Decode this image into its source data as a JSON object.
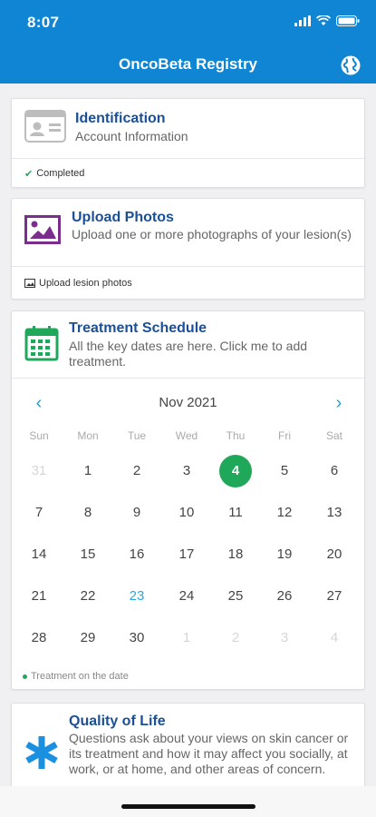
{
  "status_bar": {
    "time": "8:07",
    "icons": [
      "signal-icon",
      "wifi-icon",
      "battery-icon"
    ]
  },
  "header": {
    "title": "OncoBeta Registry",
    "globe_icon": "globe-icon",
    "color": "#0f85d3"
  },
  "cards": {
    "identification": {
      "title": "Identification",
      "subtitle": "Account Information",
      "footer": "Completed",
      "icon": "id-card-icon"
    },
    "upload": {
      "title": "Upload Photos",
      "subtitle": "Upload one or more photographs of your lesion(s)",
      "footer": "Upload lesion photos",
      "icon": "image-icon"
    },
    "schedule": {
      "title": "Treatment Schedule",
      "subtitle": "All the key dates are here. Click me to add treatment.",
      "icon": "calendar-icon",
      "calendar": {
        "month": "Nov 2021",
        "weekdays": [
          "Sun",
          "Mon",
          "Tue",
          "Wed",
          "Thu",
          "Fri",
          "Sat"
        ],
        "weeks": [
          [
            {
              "d": "31",
              "s": "muted"
            },
            {
              "d": "1"
            },
            {
              "d": "2"
            },
            {
              "d": "3"
            },
            {
              "d": "4",
              "s": "today"
            },
            {
              "d": "5"
            },
            {
              "d": "6"
            }
          ],
          [
            {
              "d": "7"
            },
            {
              "d": "8"
            },
            {
              "d": "9"
            },
            {
              "d": "10"
            },
            {
              "d": "11"
            },
            {
              "d": "12"
            },
            {
              "d": "13"
            }
          ],
          [
            {
              "d": "14"
            },
            {
              "d": "15"
            },
            {
              "d": "16"
            },
            {
              "d": "17"
            },
            {
              "d": "18"
            },
            {
              "d": "19"
            },
            {
              "d": "20"
            }
          ],
          [
            {
              "d": "21"
            },
            {
              "d": "22"
            },
            {
              "d": "23",
              "s": "accent"
            },
            {
              "d": "24"
            },
            {
              "d": "25"
            },
            {
              "d": "26"
            },
            {
              "d": "27"
            }
          ],
          [
            {
              "d": "28"
            },
            {
              "d": "29"
            },
            {
              "d": "30"
            },
            {
              "d": "1",
              "s": "muted"
            },
            {
              "d": "2",
              "s": "muted"
            },
            {
              "d": "3",
              "s": "muted"
            },
            {
              "d": "4",
              "s": "muted"
            }
          ]
        ],
        "legend": "Treatment on the date"
      }
    },
    "quality": {
      "title": "Quality of Life",
      "subtitle": "Questions ask about your views on skin cancer or its treatment and how it may affect you socially, at work, or at home, and other areas of concern.",
      "icon": "asterisk-icon"
    }
  },
  "colors": {
    "accent_blue": "#1ba3d8",
    "title_blue": "#1b4f96",
    "today_green": "#1fa85a",
    "upload_purple": "#7b2d8e"
  }
}
